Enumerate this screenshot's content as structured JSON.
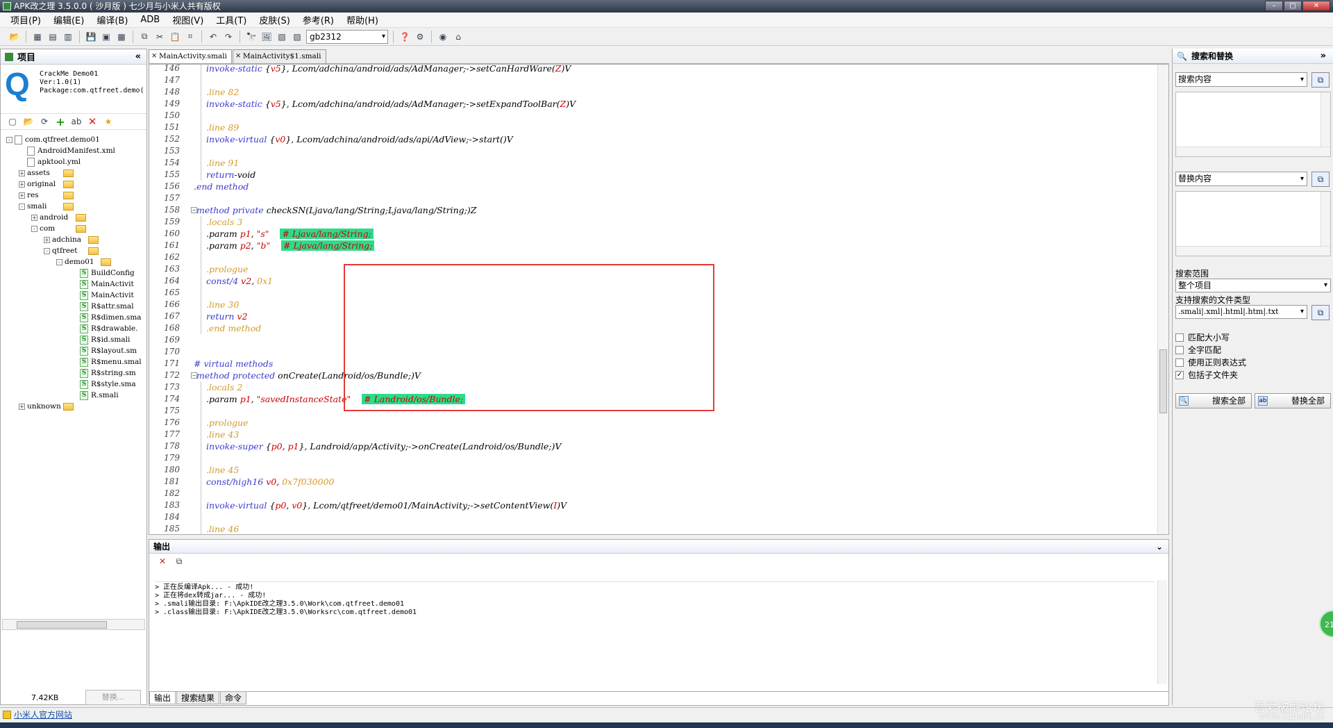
{
  "window": {
    "title": "APK改之理 3.5.0.0 ( 沙月版 )  七少月与小米人共有版权"
  },
  "menu": [
    "项目(P)",
    "编辑(E)",
    "编译(B)",
    "ADB",
    "视图(V)",
    "工具(T)",
    "皮肤(S)",
    "参考(R)",
    "帮助(H)"
  ],
  "toolbar": {
    "encoding": "gb2312"
  },
  "project": {
    "title": "项目",
    "app_name": "CrackMe Demo01",
    "app_ver": "Ver:1.0(1)",
    "app_package": "Package:com.qtfreet.demo(",
    "tree": [
      {
        "label": "com.qtfreet.demo01",
        "indent": 0,
        "kind": "root",
        "expander": "-"
      },
      {
        "label": "AndroidManifest.xml",
        "indent": 1,
        "kind": "file",
        "expander": ""
      },
      {
        "label": "apktool.yml",
        "indent": 1,
        "kind": "file",
        "expander": ""
      },
      {
        "label": "assets",
        "indent": 1,
        "kind": "folder",
        "expander": "+"
      },
      {
        "label": "original",
        "indent": 1,
        "kind": "folder",
        "expander": "+"
      },
      {
        "label": "res",
        "indent": 1,
        "kind": "folder",
        "expander": "+"
      },
      {
        "label": "smali",
        "indent": 1,
        "kind": "folder",
        "expander": "-"
      },
      {
        "label": "android",
        "indent": 2,
        "kind": "folder",
        "expander": "+"
      },
      {
        "label": "com",
        "indent": 2,
        "kind": "folder",
        "expander": "-"
      },
      {
        "label": "adchina",
        "indent": 3,
        "kind": "folder",
        "expander": "+"
      },
      {
        "label": "qtfreet",
        "indent": 3,
        "kind": "folder",
        "expander": "-"
      },
      {
        "label": "demo01",
        "indent": 4,
        "kind": "folder",
        "expander": "-"
      },
      {
        "label": "BuildConfig",
        "indent": 5,
        "kind": "smali",
        "expander": ""
      },
      {
        "label": "MainActivit",
        "indent": 5,
        "kind": "smali",
        "expander": ""
      },
      {
        "label": "MainActivit",
        "indent": 5,
        "kind": "smali",
        "expander": ""
      },
      {
        "label": "R$attr.smal",
        "indent": 5,
        "kind": "smali",
        "expander": ""
      },
      {
        "label": "R$dimen.sma",
        "indent": 5,
        "kind": "smali",
        "expander": ""
      },
      {
        "label": "R$drawable.",
        "indent": 5,
        "kind": "smali",
        "expander": ""
      },
      {
        "label": "R$id.smali",
        "indent": 5,
        "kind": "smali",
        "expander": ""
      },
      {
        "label": "R$layout.sm",
        "indent": 5,
        "kind": "smali",
        "expander": ""
      },
      {
        "label": "R$menu.smal",
        "indent": 5,
        "kind": "smali",
        "expander": ""
      },
      {
        "label": "R$string.sm",
        "indent": 5,
        "kind": "smali",
        "expander": ""
      },
      {
        "label": "R$style.sma",
        "indent": 5,
        "kind": "smali",
        "expander": ""
      },
      {
        "label": "R.smali",
        "indent": 5,
        "kind": "smali",
        "expander": ""
      },
      {
        "label": "unknown",
        "indent": 1,
        "kind": "folder",
        "expander": "+"
      }
    ],
    "size": "7.42KB",
    "replace_btn": "替换..."
  },
  "tabs": [
    "MainActivity.smali",
    "MainActivity$1.smali"
  ],
  "code": [
    {
      "n": "146",
      "indent": 1,
      "html": "<span class='kw'>invoke-static</span> {<span class='reg'>v5</span>}, Lcom/adchina/android/ads/AdManager;-&gt;setCanHardWare(<span class='reg'>Z</span>)V"
    },
    {
      "n": "147",
      "indent": 1,
      "html": ""
    },
    {
      "n": "148",
      "indent": 1,
      "html": "<span class='dir'>.line 82</span>"
    },
    {
      "n": "149",
      "indent": 1,
      "html": "<span class='kw'>invoke-static</span> {<span class='reg'>v5</span>}, Lcom/adchina/android/ads/AdManager;-&gt;setExpandToolBar(<span class='reg'>Z</span>)V"
    },
    {
      "n": "150",
      "indent": 1,
      "html": ""
    },
    {
      "n": "151",
      "indent": 1,
      "html": "<span class='dir'>.line 89</span>"
    },
    {
      "n": "152",
      "indent": 1,
      "html": "<span class='kw'>invoke-virtual</span> {<span class='reg'>v0</span>}, Lcom/adchina/android/ads/api/AdView;-&gt;start()V"
    },
    {
      "n": "153",
      "indent": 1,
      "html": ""
    },
    {
      "n": "154",
      "indent": 1,
      "html": "<span class='dir'>.line 91</span>"
    },
    {
      "n": "155",
      "indent": 1,
      "html": "<span class='kw'>return</span>-void"
    },
    {
      "n": "156",
      "indent": 0,
      "html": "<span class='kw'>.end method</span>"
    },
    {
      "n": "157",
      "indent": 0,
      "html": ""
    },
    {
      "n": "158",
      "indent": 0,
      "fold": true,
      "html": "<span class='kw'>.method private</span> checkSN(Ljava/lang/String;Ljava/lang/String;)Z"
    },
    {
      "n": "159",
      "indent": 1,
      "html": "<span class='dir'>.locals 3</span>"
    },
    {
      "n": "160",
      "indent": 1,
      "html": ".param <span class='reg'>p1</span>, <span class='str'>\"s\"</span>    <span class='ann'># Ljava/lang/String;</span>"
    },
    {
      "n": "161",
      "indent": 1,
      "html": ".param <span class='reg'>p2</span>, <span class='str'>\"b\"</span>    <span class='ann'># Ljava/lang/String;</span>"
    },
    {
      "n": "162",
      "indent": 1,
      "html": ""
    },
    {
      "n": "163",
      "indent": 1,
      "html": "<span class='dir'>.prologue</span>"
    },
    {
      "n": "164",
      "indent": 1,
      "html": "<span class='kw'>const/4</span> <span class='reg'>v2</span>, <span class='num'>0x1</span>"
    },
    {
      "n": "165",
      "indent": 1,
      "html": ""
    },
    {
      "n": "166",
      "indent": 1,
      "html": "<span class='dir'>.line 30</span>"
    },
    {
      "n": "167",
      "indent": 1,
      "html": "<span class='kw'>return</span> <span class='reg'>v2</span>"
    },
    {
      "n": "168",
      "indent": 1,
      "html": "<span class='dir'>.end method</span>"
    },
    {
      "n": "169",
      "indent": 0,
      "html": ""
    },
    {
      "n": "170",
      "indent": 0,
      "html": ""
    },
    {
      "n": "171",
      "indent": 0,
      "html": "<span class='cm'># virtual methods</span>"
    },
    {
      "n": "172",
      "indent": 0,
      "fold": true,
      "html": "<span class='kw'>.method protected</span> onCreate(Landroid/os/Bundle;)V"
    },
    {
      "n": "173",
      "indent": 1,
      "html": "<span class='dir'>.locals 2</span>"
    },
    {
      "n": "174",
      "indent": 1,
      "html": ".param <span class='reg'>p1</span>, <span class='str'>\"savedInstanceState\"</span>    <span class='ann'># Landroid/os/Bundle;</span>"
    },
    {
      "n": "175",
      "indent": 1,
      "html": ""
    },
    {
      "n": "176",
      "indent": 1,
      "html": "<span class='dir'>.prologue</span>"
    },
    {
      "n": "177",
      "indent": 1,
      "html": "<span class='dir'>.line 43</span>"
    },
    {
      "n": "178",
      "indent": 1,
      "html": "<span class='kw'>invoke-super</span> {<span class='reg'>p0</span>, <span class='reg'>p1</span>}, Landroid/app/Activity;-&gt;onCreate(Landroid/os/Bundle;)V"
    },
    {
      "n": "179",
      "indent": 1,
      "html": ""
    },
    {
      "n": "180",
      "indent": 1,
      "html": "<span class='dir'>.line 45</span>"
    },
    {
      "n": "181",
      "indent": 1,
      "html": "<span class='kw'>const/high16</span> <span class='reg'>v0</span>, <span class='num'>0x7f030000</span>"
    },
    {
      "n": "182",
      "indent": 1,
      "html": ""
    },
    {
      "n": "183",
      "indent": 1,
      "html": "<span class='kw'>invoke-virtual</span> {<span class='reg'>p0</span>, <span class='reg'>v0</span>}, Lcom/qtfreet/demo01/MainActivity;-&gt;setContentView(<span class='reg'>I</span>)V"
    },
    {
      "n": "184",
      "indent": 1,
      "html": ""
    },
    {
      "n": "185",
      "indent": 1,
      "html": "<span class='dir'>.line 46</span>"
    }
  ],
  "output": {
    "title": "输出",
    "lines": [
      "> 正在反编译Apk...  - 成功!",
      "> 正在将dex转成jar...  - 成功!",
      "> .smali输出目录: F:\\ApkIDE改之理3.5.0\\Work\\com.qtfreet.demo01",
      "> .class输出目录: F:\\ApkIDE改之理3.5.0\\Worksrc\\com.qtfreet.demo01"
    ],
    "tabs": [
      "输出",
      "搜索结果",
      "命令"
    ]
  },
  "search": {
    "title": "搜索和替换",
    "search_placeholder": "搜索内容",
    "replace_placeholder": "替换内容",
    "scope_label": "搜索范围",
    "scope_value": "整个项目",
    "types_label": "支持搜索的文件类型",
    "types_value": ".smali|.xml|.html|.htm|.txt",
    "options": [
      {
        "label": "匹配大小写",
        "checked": false
      },
      {
        "label": "全字匹配",
        "checked": false
      },
      {
        "label": "使用正则表达式",
        "checked": false
      },
      {
        "label": "包括子文件夹",
        "checked": true
      }
    ],
    "search_all": "搜索全部",
    "replace_all": "替换全部"
  },
  "status": {
    "link": "小米人官方网站"
  },
  "watermark": {
    "line1": "吾爱破解论坛",
    "line2": "www.52pojie.cn"
  },
  "badge": "21"
}
